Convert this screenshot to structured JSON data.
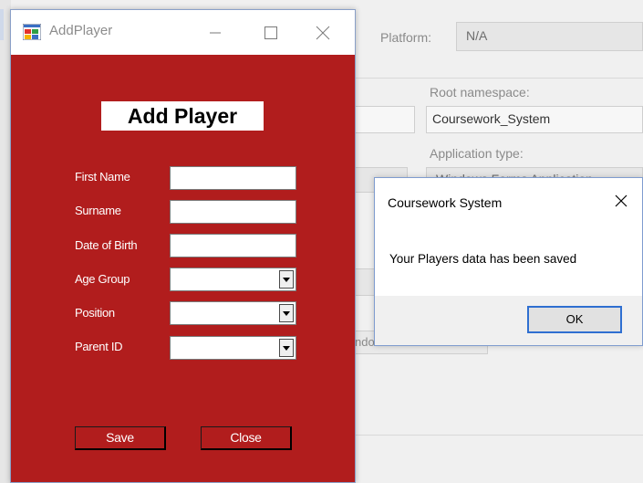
{
  "background": {
    "platform_label": "Platform:",
    "platform_value": "N/A",
    "root_namespace_label": "Root namespace:",
    "root_namespace_value": "Coursework_System",
    "application_type_label": "Application type:",
    "application_type_value": "Windows Forms Application",
    "partial_button_text": "ndo"
  },
  "window": {
    "title": "AddPlayer",
    "heading": "Add Player",
    "fields": {
      "first_name_label": "First Name",
      "surname_label": "Surname",
      "dob_label": "Date of Birth",
      "age_group_label": "Age Group",
      "position_label": "Position",
      "parent_id_label": "Parent ID",
      "first_name_value": "",
      "surname_value": "",
      "dob_value": "",
      "age_group_value": "",
      "position_value": "",
      "parent_id_value": ""
    },
    "save_label": "Save",
    "close_label": "Close"
  },
  "message_box": {
    "title": "Coursework System",
    "text": "Your Players data has been saved",
    "ok_label": "OK"
  },
  "colors": {
    "form_background": "#b11d1d",
    "focus_border": "#2f6fd1"
  }
}
